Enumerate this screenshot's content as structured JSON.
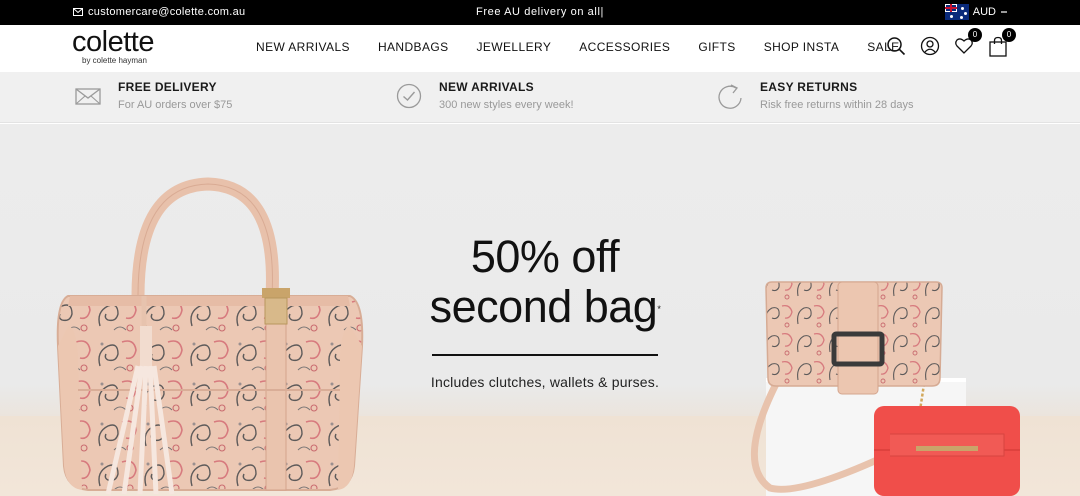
{
  "topbar": {
    "email": "customercare@colette.com.au",
    "promo": "Free AU delivery on all|",
    "currency": "AUD"
  },
  "header": {
    "logo": "colette",
    "logo_sub": "by colette hayman",
    "nav": [
      "NEW ARRIVALS",
      "HANDBAGS",
      "JEWELLERY",
      "ACCESSORIES",
      "GIFTS",
      "SHOP INSTA",
      "SALE"
    ],
    "wishlist_count": "0",
    "cart_count": "0"
  },
  "features": [
    {
      "title": "FREE DELIVERY",
      "subtitle": "For AU orders over $75",
      "icon": "envelope-icon"
    },
    {
      "title": "NEW ARRIVALS",
      "subtitle": "300 new styles every week!",
      "icon": "check-circle-icon"
    },
    {
      "title": "EASY RETURNS",
      "subtitle": "Risk free returns within 28 days",
      "icon": "return-arrow-icon"
    }
  ],
  "hero": {
    "line1": "50% off",
    "line2": "second bag",
    "asterisk": "*",
    "line3": "Includes clutches, wallets & purses."
  },
  "colors": {
    "topbar_bg": "#000000",
    "features_bg": "#f0f0f0",
    "bag_pink": "#e8bfa8",
    "wallet_red": "#f04e4a"
  }
}
